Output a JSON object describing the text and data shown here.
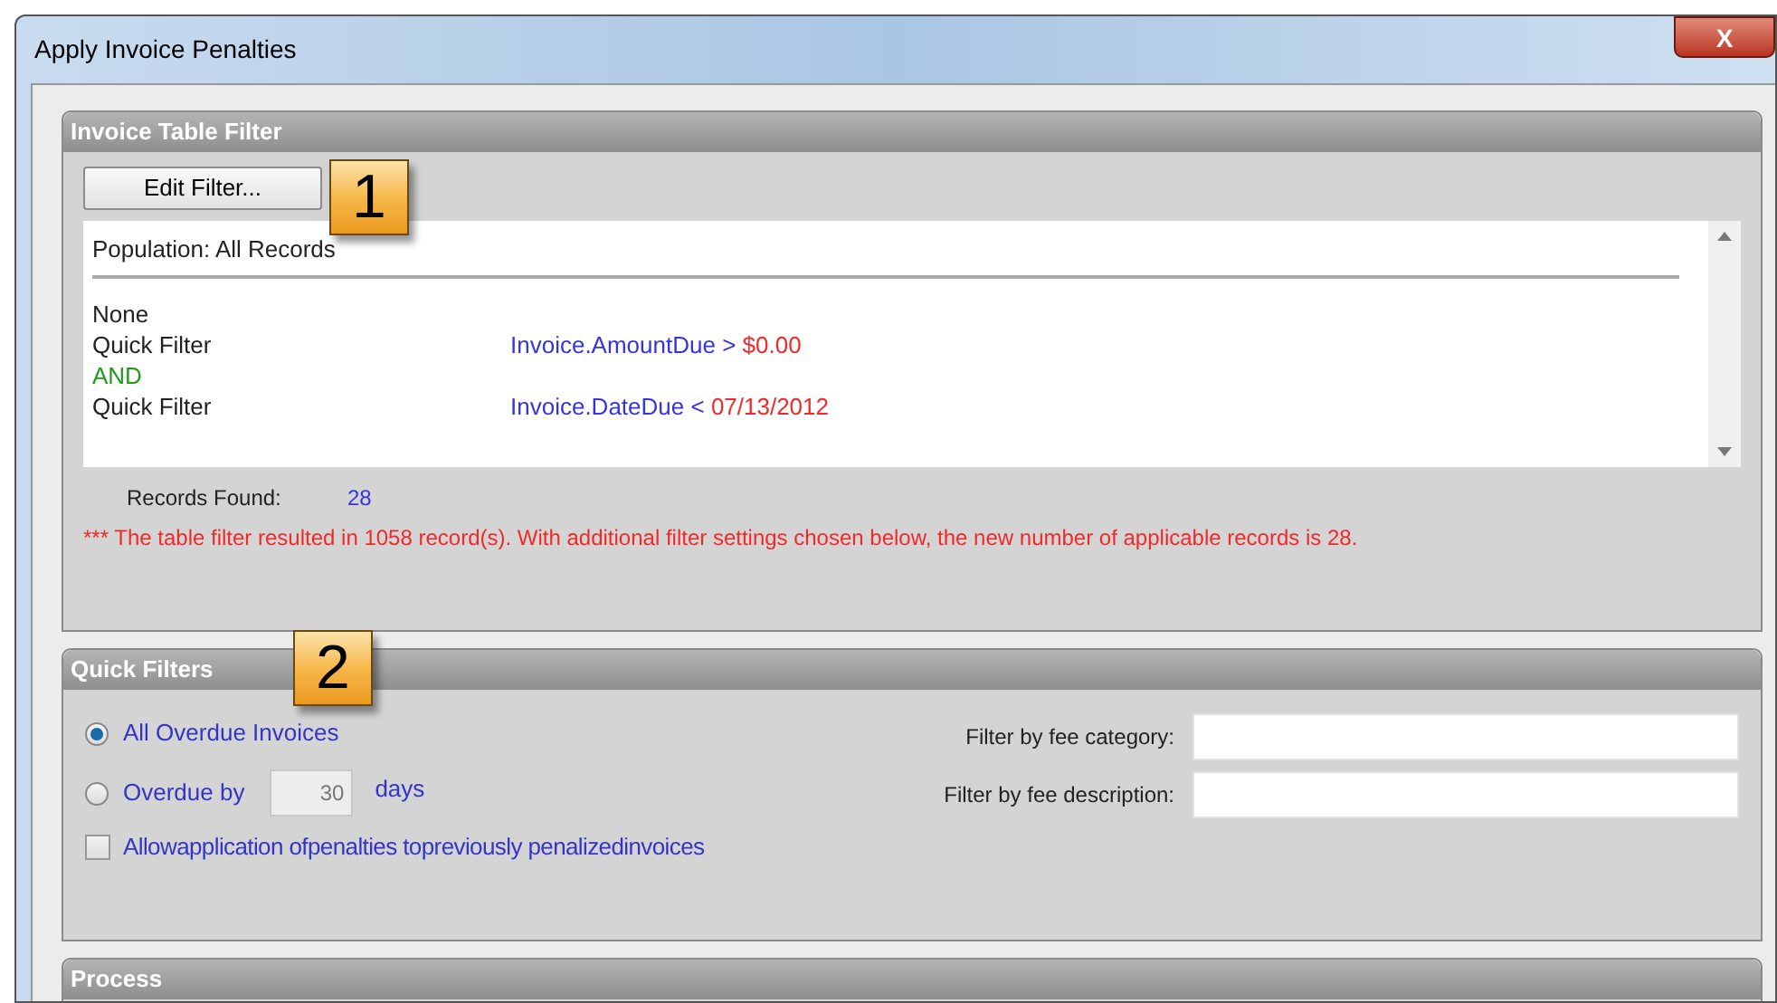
{
  "window": {
    "title": "Apply Invoice Penalties",
    "close": "X"
  },
  "invoice_table_filter": {
    "title": "Invoice Table Filter",
    "edit_button": "Edit Filter...",
    "callout": "1",
    "population": "Population: All Records",
    "lines": [
      {
        "kind": "label",
        "label": "None"
      },
      {
        "kind": "condition",
        "label": "Quick Filter",
        "field": "Invoice.AmountDue",
        "operator": ">",
        "value": "$0.00"
      },
      {
        "kind": "operator",
        "label": "AND"
      },
      {
        "kind": "condition",
        "label": "Quick Filter",
        "field": "Invoice.DateDue",
        "operator": "<",
        "value": "07/13/2012"
      }
    ],
    "records_found_label": "Records Found:",
    "records_found": "28",
    "message": "*** The table filter resulted in 1058 record(s).  With additional filter settings chosen below, the new number of applicable records is 28."
  },
  "quick_filters": {
    "title": "Quick Filters",
    "callout": "2",
    "options": [
      {
        "label": "All Overdue Invoices",
        "selected": true
      },
      {
        "label": "Overdue by",
        "selected": false,
        "days_value": "30",
        "days_unit": "days"
      }
    ],
    "allow_penalized": {
      "label": "Allowapplication ofpenalties topreviously penalizedinvoices",
      "checked": false
    },
    "fee_filters": [
      {
        "label": "Filter by fee category:"
      },
      {
        "label": "Filter by fee description:"
      }
    ]
  },
  "process": {
    "title": "Process"
  }
}
